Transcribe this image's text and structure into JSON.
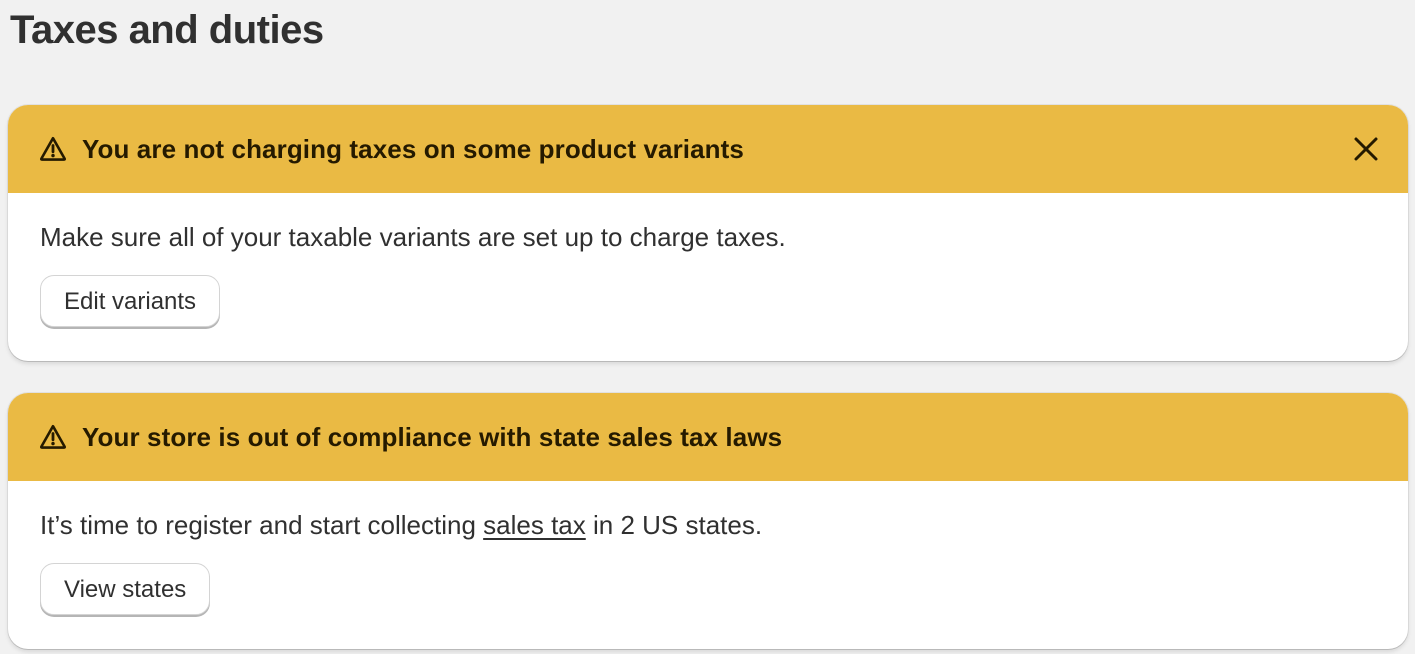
{
  "page": {
    "title": "Taxes and duties"
  },
  "colors": {
    "banner_warning": "#eaba44",
    "background": "#f1f1f1",
    "text": "#303030"
  },
  "banners": [
    {
      "icon": "warning-triangle-icon",
      "title": "You are not charging taxes on some product variants",
      "dismissible": true,
      "close_icon": "close-icon",
      "message": "Make sure all of your taxable variants are set up to charge taxes.",
      "action_label": "Edit variants"
    },
    {
      "icon": "warning-triangle-icon",
      "title": "Your store is out of compliance with state sales tax laws",
      "dismissible": false,
      "message_prefix": "It’s time to register and start collecting ",
      "message_link": "sales tax",
      "message_suffix": " in 2 US states.",
      "action_label": "View states"
    }
  ]
}
